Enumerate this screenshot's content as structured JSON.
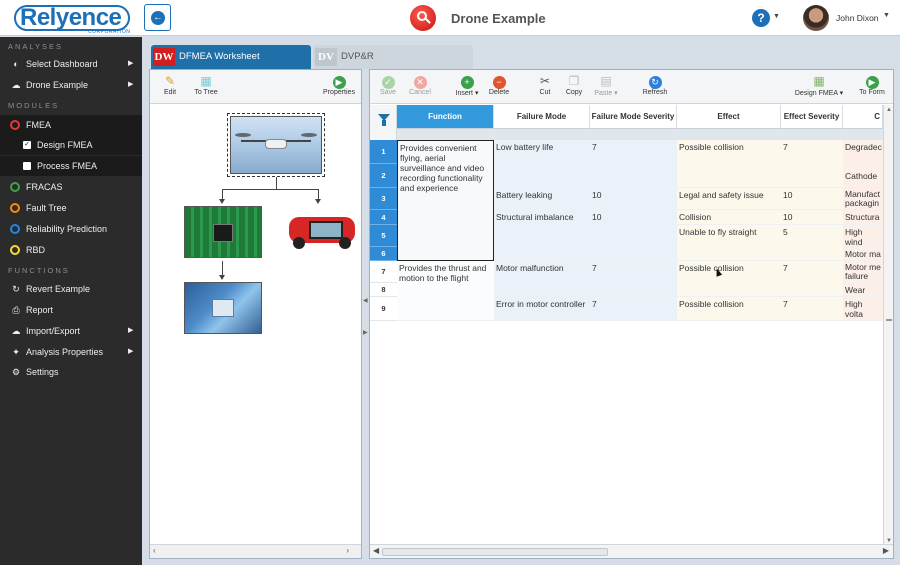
{
  "header": {
    "logo_text": "Relyence",
    "logo_sub": "CORPORATION",
    "title": "Drone Example",
    "help_label": "?",
    "user_name": "John Dixon"
  },
  "sidebar": {
    "sections": [
      {
        "heading": "ANALYSES"
      },
      {
        "heading": "MODULES"
      },
      {
        "heading": "FUNCTIONS"
      }
    ],
    "analyses": [
      {
        "label": "Select Dashboard",
        "icon": "dashboard-icon"
      },
      {
        "label": "Drone Example",
        "icon": "cloud-icon"
      }
    ],
    "modules": [
      {
        "label": "FMEA",
        "color": "#e53935"
      },
      {
        "label": "Design FMEA"
      },
      {
        "label": "Process FMEA"
      },
      {
        "label": "FRACAS",
        "color": "#43a047"
      },
      {
        "label": "Fault Tree",
        "color": "#fb8c00"
      },
      {
        "label": "Reliability Prediction",
        "color": "#1e88e5"
      },
      {
        "label": "RBD",
        "color": "#fdd835"
      }
    ],
    "functions": [
      {
        "label": "Revert Example",
        "icon": "refresh-icon"
      },
      {
        "label": "Report",
        "icon": "printer-icon"
      },
      {
        "label": "Import/Export",
        "icon": "cloud-upload-icon"
      },
      {
        "label": "Analysis Properties",
        "icon": "wrench-icon"
      },
      {
        "label": "Settings",
        "icon": "gear-icon"
      }
    ]
  },
  "tabs": [
    {
      "badge": "DW",
      "label": "DFMEA Worksheet"
    },
    {
      "badge": "DV",
      "label": "DVP&R"
    }
  ],
  "tree_toolbar": {
    "edit": "Edit",
    "to_tree": "To Tree",
    "properties": "Properties"
  },
  "ws_toolbar": {
    "save": "Save",
    "cancel": "Cancel",
    "insert": "Insert",
    "delete": "Delete",
    "cut": "Cut",
    "copy": "Copy",
    "paste": "Paste",
    "refresh": "Refresh",
    "design_fmea": "Design FMEA",
    "to_form": "To Form"
  },
  "grid": {
    "columns": [
      "Function",
      "Failure Mode",
      "Failure Mode Severity",
      "Effect",
      "Effect Severity",
      "C"
    ],
    "row_numbers": [
      "1",
      "2",
      "3",
      "4",
      "5",
      "6",
      "7",
      "8",
      "9"
    ],
    "functions": [
      "Provides convenient flying, aerial surveillance and video recording functionality and experience",
      "Provides the thrust and motion to the flight"
    ],
    "failure_modes": [
      {
        "mode": "Low battery life",
        "severity": "7"
      },
      {
        "mode": "Battery leaking",
        "severity": "10"
      },
      {
        "mode": "Structural imbalance",
        "severity": "10"
      },
      {
        "mode": "Motor malfunction",
        "severity": "7"
      },
      {
        "mode": "Error in motor controller",
        "severity": "7"
      }
    ],
    "effects": [
      {
        "effect": "Possible collision",
        "severity": "7"
      },
      {
        "effect": "Legal and safety issue",
        "severity": "10"
      },
      {
        "effect": "Collision",
        "severity": "10"
      },
      {
        "effect": "Unable to fly straight",
        "severity": "5"
      },
      {
        "effect": "Possible collision",
        "severity": "7"
      },
      {
        "effect": "Possible collision",
        "severity": "7"
      }
    ],
    "causes": [
      "Degradec",
      "Cathode",
      "Manufact packagin",
      "Structura",
      "High wind",
      "Motor ma",
      "Motor me failure",
      "Wear",
      "High volta"
    ]
  }
}
